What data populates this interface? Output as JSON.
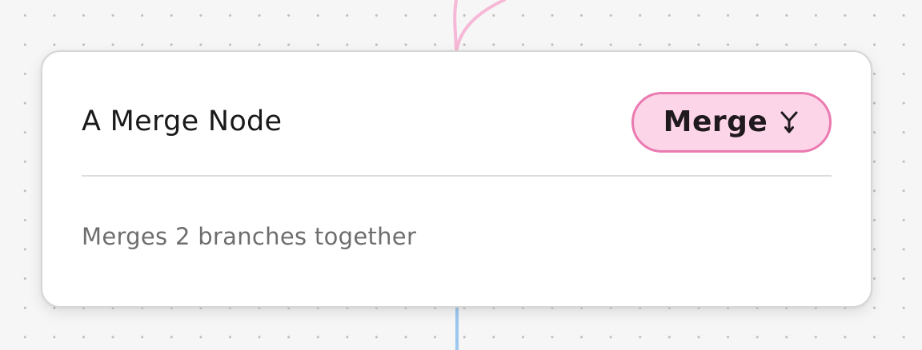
{
  "node": {
    "title": "A Merge Node",
    "badge": {
      "label": "Merge",
      "icon": "merge-icon",
      "border_color": "#ea7ab0",
      "fill_color": "#fdd5e8"
    },
    "description": "Merges 2 branches together"
  },
  "edges": {
    "incoming_color": "#f6b8d6",
    "outgoing_color": "#9cc8f0"
  }
}
